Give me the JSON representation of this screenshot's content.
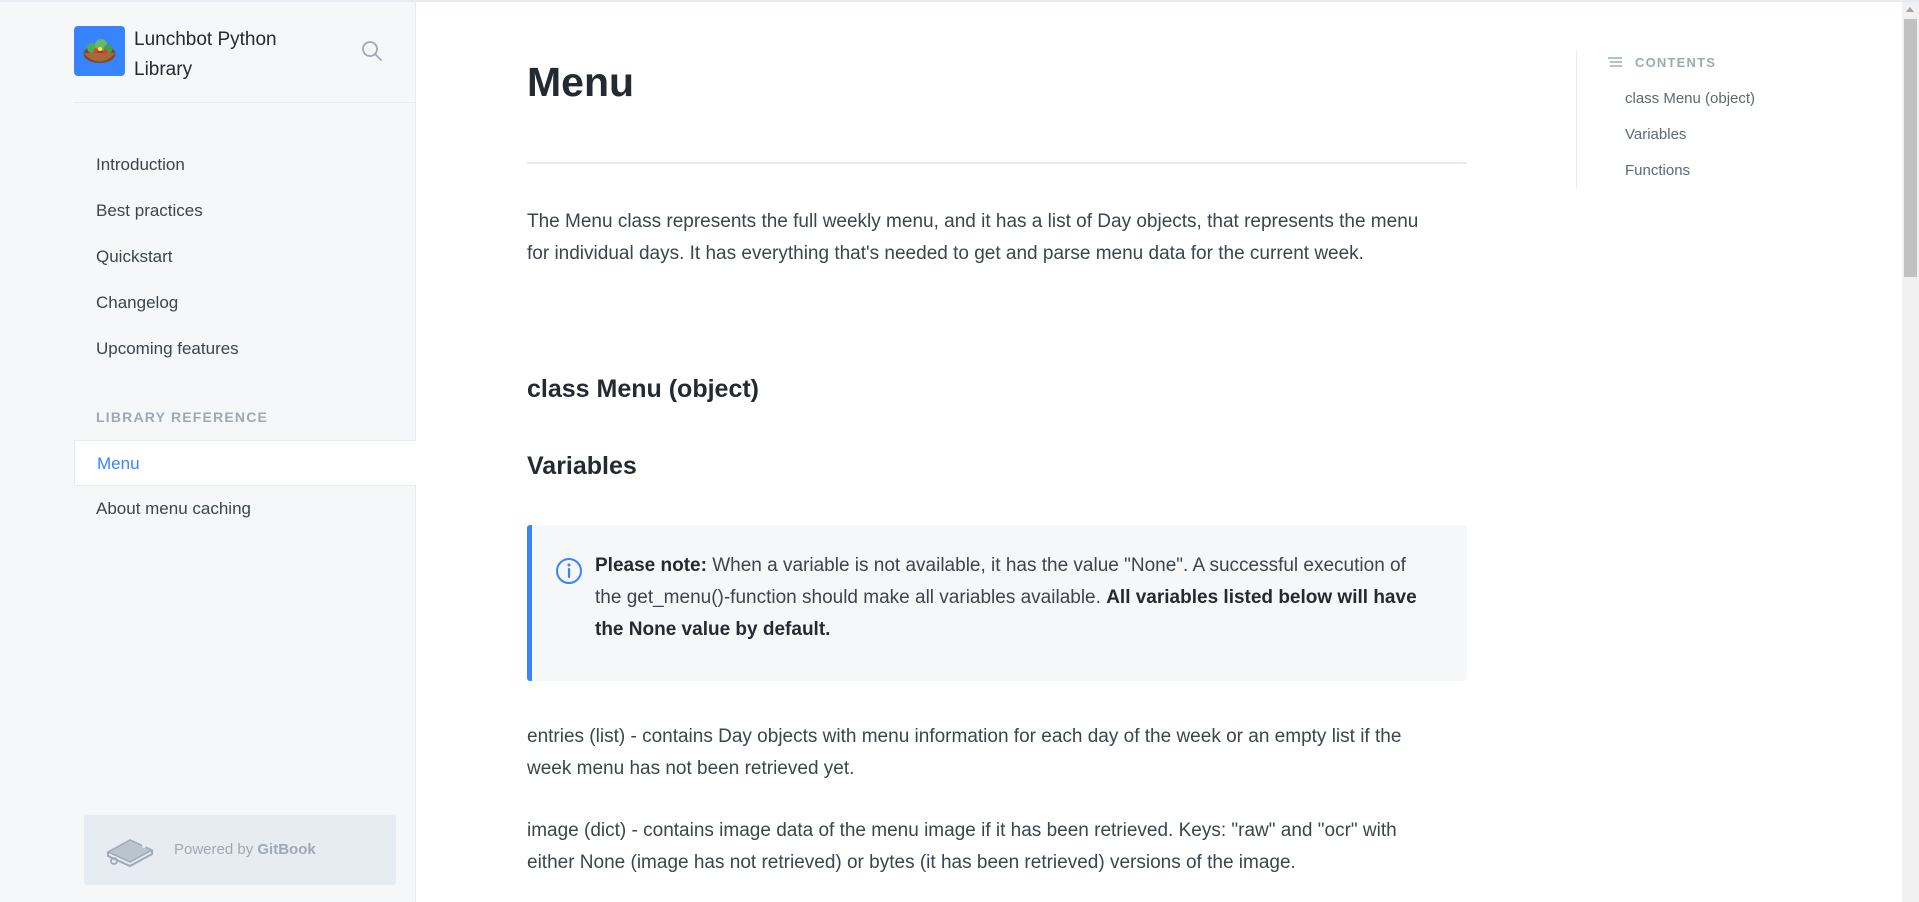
{
  "brand": {
    "title": "Lunchbot Python Library",
    "logo_emoji": "🥗"
  },
  "sidebar": {
    "items": [
      {
        "label": "Introduction"
      },
      {
        "label": "Best practices"
      },
      {
        "label": "Quickstart"
      },
      {
        "label": "Changelog"
      },
      {
        "label": "Upcoming features"
      }
    ],
    "section_label": "LIBRARY REFERENCE",
    "reference_items": [
      {
        "label": "Menu",
        "active": true
      },
      {
        "label": "About menu caching",
        "active": false
      }
    ],
    "powered_prefix": "Powered by",
    "powered_brand": "GitBook"
  },
  "main": {
    "title": "Menu",
    "intro_line1": "The Menu class represents the full weekly menu, and it has a list of Day objects, that represents the menu",
    "intro_line2": "for individual days. It has everything that's needed to get and parse menu data for the current week.",
    "heading_class": "class Menu (object)",
    "heading_variables": "Variables",
    "hint": {
      "lead": "Please note:",
      "text": "When a variable is not available, it has the value \"None\". A successful execution of the get_menu()-function should make all variables available.",
      "bold_tail": "All variables listed below will have the None value by default."
    },
    "entries_line1": "entries (list) - contains Day objects with menu information for each day of the week or an empty list if the",
    "entries_line2": "week menu has not been retrieved yet.",
    "image_line1": "image (dict) - contains image data of the menu image if it has been retrieved. Keys: \"raw\" and \"ocr\" with",
    "image_line2": "either None (image has not retrieved) or bytes (it has been retrieved) versions of the image."
  },
  "toc": {
    "heading": "CONTENTS",
    "items": [
      {
        "label": "class Menu (object)"
      },
      {
        "label": "Variables"
      },
      {
        "label": "Functions"
      }
    ]
  },
  "colors": {
    "accent": "#3884ff",
    "sidebar_bg": "#f5f7f9",
    "heading": "#242a31"
  }
}
